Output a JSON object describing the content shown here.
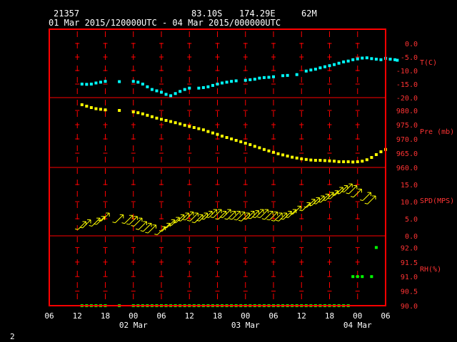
{
  "header": {
    "station": "21357",
    "lat": "83.10S",
    "lon": "174.29E",
    "elev": "62M",
    "period": "01 Mar 2015/120000UTC - 04 Mar 2015/000000UTC"
  },
  "footer": {
    "page": "2"
  },
  "colors": {
    "frame": "#ff0000",
    "temp": "#00ffff",
    "pressure": "#ffff00",
    "wind": "#ffff00",
    "rh": "#00ff00",
    "text": "#ffffff",
    "axis_text": "#ff3333"
  },
  "chart_data": {
    "type": "scatter",
    "x_axis": {
      "unit": "hours",
      "range": [
        6,
        78
      ],
      "ticks": [
        {
          "h": 6,
          "label": "06"
        },
        {
          "h": 12,
          "label": "12"
        },
        {
          "h": 18,
          "label": "18"
        },
        {
          "h": 24,
          "label": "00"
        },
        {
          "h": 30,
          "label": "06"
        },
        {
          "h": 36,
          "label": "12"
        },
        {
          "h": 42,
          "label": "18"
        },
        {
          "h": 48,
          "label": "00"
        },
        {
          "h": 54,
          "label": "06"
        },
        {
          "h": 60,
          "label": "12"
        },
        {
          "h": 66,
          "label": "18"
        },
        {
          "h": 72,
          "label": "00"
        },
        {
          "h": 78,
          "label": "06"
        }
      ],
      "dates": [
        {
          "h": 24,
          "label": "02 Mar"
        },
        {
          "h": 48,
          "label": "03 Mar"
        },
        {
          "h": 72,
          "label": "04 Mar"
        }
      ]
    },
    "panels": [
      {
        "name": "T(C)",
        "ylim": [
          -20,
          0
        ],
        "ticks": [
          "0.0",
          "-5.0",
          "-10.0",
          "-15.0",
          "-20.0"
        ],
        "tick_values": [
          0,
          -5,
          -10,
          -15,
          -20
        ],
        "points": [
          [
            13,
            -15.0
          ],
          [
            14,
            -15.1
          ],
          [
            15,
            -15.0
          ],
          [
            16,
            -14.6
          ],
          [
            17,
            -14.3
          ],
          [
            18,
            -14.0
          ],
          [
            21,
            -14.1
          ],
          [
            24,
            -14.0
          ],
          [
            25,
            -14.3
          ],
          [
            26,
            -15.0
          ],
          [
            27,
            -16.0
          ],
          [
            28,
            -17.0
          ],
          [
            29,
            -17.5
          ],
          [
            30,
            -18.0
          ],
          [
            31,
            -18.8
          ],
          [
            32,
            -19.3
          ],
          [
            33,
            -18.5
          ],
          [
            34,
            -17.7
          ],
          [
            35,
            -17.0
          ],
          [
            36,
            -16.5
          ],
          [
            38,
            -16.5
          ],
          [
            39,
            -16.3
          ],
          [
            40,
            -16.0
          ],
          [
            41,
            -15.5
          ],
          [
            42,
            -15.0
          ],
          [
            43,
            -14.6
          ],
          [
            44,
            -14.3
          ],
          [
            45,
            -14.0
          ],
          [
            46,
            -13.8
          ],
          [
            48,
            -13.6
          ],
          [
            49,
            -13.4
          ],
          [
            50,
            -13.2
          ],
          [
            51,
            -12.8
          ],
          [
            52,
            -12.6
          ],
          [
            53,
            -12.5
          ],
          [
            54,
            -12.3
          ],
          [
            56,
            -11.9
          ],
          [
            57,
            -11.8
          ],
          [
            59,
            -11.5
          ],
          [
            61,
            -10.2
          ],
          [
            62,
            -9.8
          ],
          [
            63,
            -9.5
          ],
          [
            64,
            -9.0
          ],
          [
            65,
            -8.6
          ],
          [
            66,
            -8.2
          ],
          [
            67,
            -7.8
          ],
          [
            68,
            -7.3
          ],
          [
            69,
            -6.8
          ],
          [
            70,
            -6.5
          ],
          [
            71,
            -6.0
          ],
          [
            72,
            -5.7
          ],
          [
            73,
            -5.4
          ],
          [
            74,
            -5.3
          ],
          [
            75,
            -5.6
          ],
          [
            76,
            -5.8
          ],
          [
            77,
            -6.0
          ],
          [
            78,
            -5.5
          ],
          [
            79,
            -5.8
          ],
          [
            80,
            -6.0
          ],
          [
            80.5,
            -6.2
          ]
        ]
      },
      {
        "name": "Pre (mb)",
        "ylim": [
          960,
          985
        ],
        "ticks": [
          "980.0",
          "975.0",
          "970.0",
          "965.0",
          "960.0"
        ],
        "tick_values": [
          980,
          975,
          970,
          965,
          960
        ],
        "points": [
          [
            13,
            982.0
          ],
          [
            14,
            981.5
          ],
          [
            15,
            981.0
          ],
          [
            16,
            980.6
          ],
          [
            17,
            980.4
          ],
          [
            18,
            980.2
          ],
          [
            21,
            980.0
          ],
          [
            24,
            979.5
          ],
          [
            25,
            979.2
          ],
          [
            26,
            978.8
          ],
          [
            27,
            978.3
          ],
          [
            28,
            977.8
          ],
          [
            29,
            977.3
          ],
          [
            30,
            976.9
          ],
          [
            31,
            976.5
          ],
          [
            32,
            976.1
          ],
          [
            33,
            975.7
          ],
          [
            34,
            975.3
          ],
          [
            35,
            974.8
          ],
          [
            36,
            974.4
          ],
          [
            37,
            974.0
          ],
          [
            38,
            973.6
          ],
          [
            39,
            973.2
          ],
          [
            40,
            972.6
          ],
          [
            41,
            972.1
          ],
          [
            42,
            971.6
          ],
          [
            43,
            971.0
          ],
          [
            44,
            970.5
          ],
          [
            45,
            970.0
          ],
          [
            46,
            969.5
          ],
          [
            47,
            969.0
          ],
          [
            48,
            968.5
          ],
          [
            49,
            968.0
          ],
          [
            50,
            967.4
          ],
          [
            51,
            966.9
          ],
          [
            52,
            966.3
          ],
          [
            53,
            965.8
          ],
          [
            54,
            965.3
          ],
          [
            55,
            964.8
          ],
          [
            56,
            964.4
          ],
          [
            57,
            964.0
          ],
          [
            58,
            963.6
          ],
          [
            59,
            963.3
          ],
          [
            60,
            963.0
          ],
          [
            61,
            962.8
          ],
          [
            62,
            962.6
          ],
          [
            63,
            962.5
          ],
          [
            64,
            962.5
          ],
          [
            65,
            962.4
          ],
          [
            66,
            962.3
          ],
          [
            67,
            962.2
          ],
          [
            68,
            962.0
          ],
          [
            69,
            962.0
          ],
          [
            70,
            962.0
          ],
          [
            71,
            961.9
          ],
          [
            72,
            962.0
          ],
          [
            73,
            962.2
          ],
          [
            74,
            962.7
          ],
          [
            75,
            963.5
          ],
          [
            76,
            964.5
          ],
          [
            77,
            965.5
          ],
          [
            78,
            966.3
          ]
        ]
      },
      {
        "name": "SPD(MPS)",
        "ylim": [
          0,
          15
        ],
        "ticks": [
          "15.0",
          "10.0",
          "5.0",
          "0.0"
        ],
        "tick_values": [
          15,
          10,
          5,
          0
        ],
        "points": [
          [
            13,
            3.0
          ],
          [
            14,
            3.5
          ],
          [
            16,
            4.0
          ],
          [
            17,
            4.5
          ],
          [
            18,
            5.5
          ],
          [
            21,
            5.0
          ],
          [
            23,
            4.8
          ],
          [
            24,
            4.5
          ],
          [
            25,
            4.0
          ],
          [
            26,
            3.0
          ],
          [
            27,
            2.5
          ],
          [
            28,
            2.0
          ],
          [
            30,
            1.5
          ],
          [
            31,
            2.5
          ],
          [
            32,
            3.5
          ],
          [
            33,
            4.2
          ],
          [
            34,
            5.0
          ],
          [
            35,
            5.5
          ],
          [
            36,
            5.8
          ],
          [
            37,
            5.5
          ],
          [
            38,
            5.0
          ],
          [
            39,
            5.5
          ],
          [
            40,
            6.0
          ],
          [
            41,
            6.5
          ],
          [
            42,
            6.5
          ],
          [
            43,
            6.0
          ],
          [
            44,
            6.5
          ],
          [
            45,
            6.0
          ],
          [
            46,
            6.0
          ],
          [
            47,
            5.8
          ],
          [
            48,
            5.5
          ],
          [
            49,
            6.0
          ],
          [
            50,
            6.2
          ],
          [
            51,
            6.5
          ],
          [
            52,
            6.5
          ],
          [
            53,
            6.0
          ],
          [
            54,
            5.8
          ],
          [
            55,
            5.5
          ],
          [
            56,
            5.5
          ],
          [
            57,
            6.0
          ],
          [
            58,
            6.5
          ],
          [
            59,
            7.5
          ],
          [
            61,
            8.5
          ],
          [
            62,
            9.5
          ],
          [
            63,
            10.0
          ],
          [
            64,
            10.5
          ],
          [
            65,
            11.0
          ],
          [
            66,
            11.5
          ],
          [
            67,
            12.0
          ],
          [
            68,
            13.0
          ],
          [
            69,
            13.5
          ],
          [
            70,
            14.0
          ],
          [
            71,
            13.5
          ],
          [
            72,
            12.5
          ],
          [
            74,
            11.5
          ],
          [
            75,
            10.5
          ]
        ]
      },
      {
        "name": "RH(%)",
        "ylim": [
          90,
          92.5
        ],
        "ticks": [
          "92.0",
          "91.5",
          "91.0",
          "90.5",
          "90.0"
        ],
        "tick_values": [
          92,
          91.5,
          91,
          90.5,
          90
        ],
        "points": [
          [
            13,
            90.0
          ],
          [
            14,
            90.0
          ],
          [
            15,
            90.0
          ],
          [
            16,
            90.0
          ],
          [
            17,
            90.0
          ],
          [
            18,
            90.0
          ],
          [
            21,
            90.0
          ],
          [
            24,
            90.0
          ],
          [
            25,
            90.0
          ],
          [
            26,
            90.0
          ],
          [
            27,
            90.0
          ],
          [
            28,
            90.0
          ],
          [
            29,
            90.0
          ],
          [
            30,
            90.0
          ],
          [
            31,
            90.0
          ],
          [
            32,
            90.0
          ],
          [
            33,
            90.0
          ],
          [
            34,
            90.0
          ],
          [
            35,
            90.0
          ],
          [
            36,
            90.0
          ],
          [
            37,
            90.0
          ],
          [
            38,
            90.0
          ],
          [
            39,
            90.0
          ],
          [
            40,
            90.0
          ],
          [
            41,
            90.0
          ],
          [
            42,
            90.0
          ],
          [
            43,
            90.0
          ],
          [
            44,
            90.0
          ],
          [
            45,
            90.0
          ],
          [
            46,
            90.0
          ],
          [
            47,
            90.0
          ],
          [
            48,
            90.0
          ],
          [
            49,
            90.0
          ],
          [
            50,
            90.0
          ],
          [
            51,
            90.0
          ],
          [
            52,
            90.0
          ],
          [
            53,
            90.0
          ],
          [
            54,
            90.0
          ],
          [
            55,
            90.0
          ],
          [
            56,
            90.0
          ],
          [
            57,
            90.0
          ],
          [
            58,
            90.0
          ],
          [
            59,
            90.0
          ],
          [
            60,
            90.0
          ],
          [
            61,
            90.0
          ],
          [
            62,
            90.0
          ],
          [
            63,
            90.0
          ],
          [
            64,
            90.0
          ],
          [
            65,
            90.0
          ],
          [
            66,
            90.0
          ],
          [
            67,
            90.0
          ],
          [
            68,
            90.0
          ],
          [
            69,
            90.0
          ],
          [
            70,
            90.0
          ],
          [
            71,
            91.0
          ],
          [
            72,
            91.0
          ],
          [
            73,
            91.0
          ],
          [
            75,
            91.0
          ],
          [
            76,
            92.0
          ]
        ]
      }
    ]
  }
}
